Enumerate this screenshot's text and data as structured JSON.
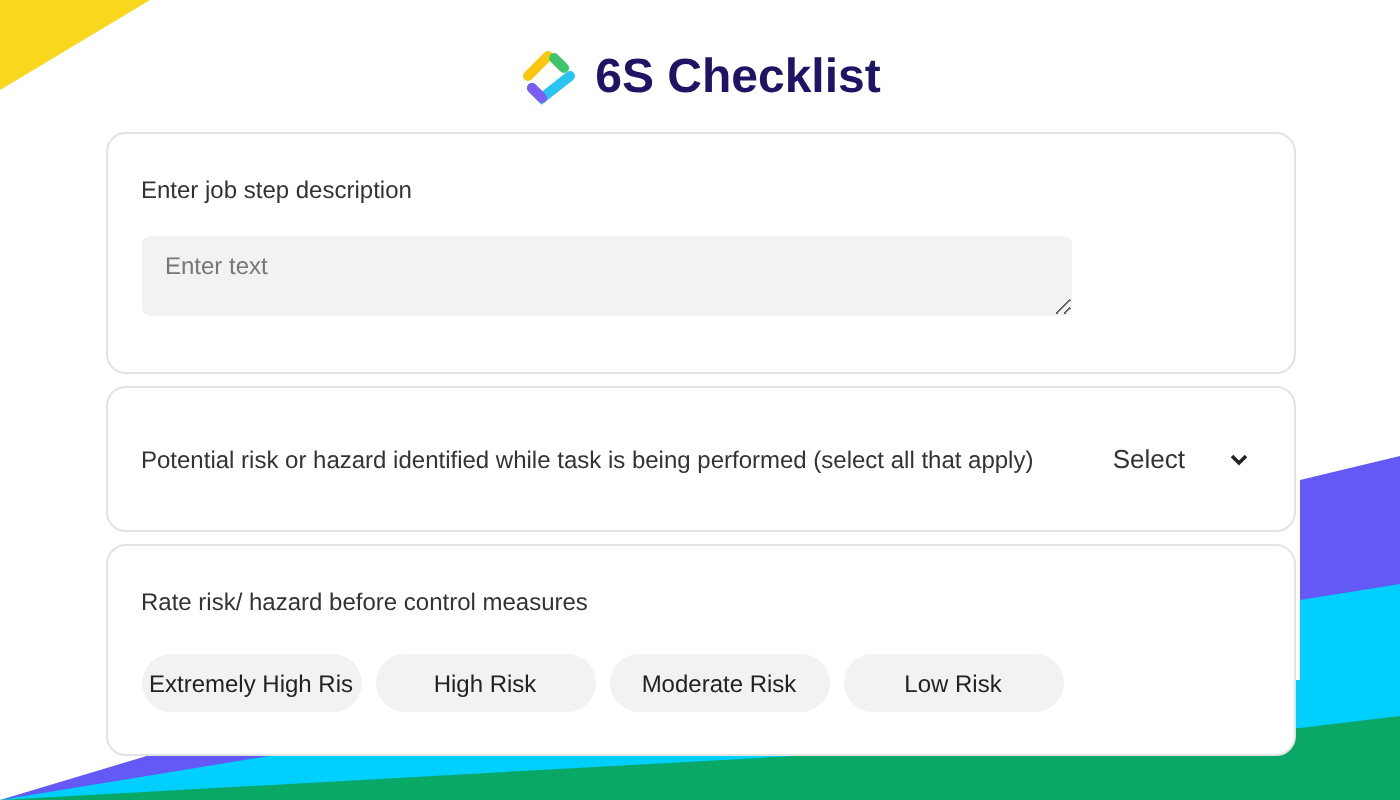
{
  "header": {
    "title": "6S Checklist"
  },
  "job_step": {
    "label": "Enter job step description",
    "placeholder": "Enter text"
  },
  "risk_question": {
    "label": "Potential risk or hazard identified while task is being performed (select all that apply)",
    "select": "Select"
  },
  "rating": {
    "label": "Rate risk/ hazard before control measures",
    "options": [
      {
        "label": "Extremely High Ris"
      },
      {
        "label": "High Risk"
      },
      {
        "label": "Moderate Risk"
      },
      {
        "label": "Low Risk"
      }
    ]
  }
}
